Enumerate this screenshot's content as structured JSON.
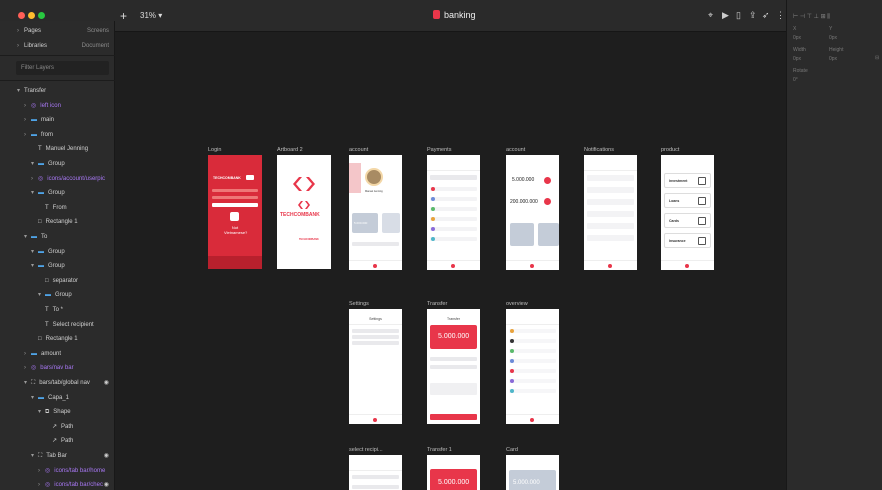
{
  "toolbar": {
    "plus": "+",
    "zoom": "31%",
    "title": "banking",
    "colors": {
      "red": "#ff5f57",
      "yellow": "#febc2e",
      "green": "#28c840",
      "brand": "#e8364a"
    }
  },
  "left_panel": {
    "pages_label": "Pages",
    "pages_right": "Screens",
    "libraries_label": "Libraries",
    "libraries_right": "Document",
    "filter_placeholder": "Filter Layers",
    "layers": [
      {
        "label": "Transfer",
        "icon": "none",
        "indent": 0
      },
      {
        "label": "left icon",
        "icon": "symbol",
        "indent": 1
      },
      {
        "label": "main",
        "icon": "folder",
        "indent": 1
      },
      {
        "label": "from",
        "icon": "folder",
        "indent": 1
      },
      {
        "label": "Manuel Jenning",
        "icon": "text",
        "indent": 2
      },
      {
        "label": "Group",
        "icon": "folder",
        "indent": 2
      },
      {
        "label": "icons/account/userpic",
        "icon": "symbol",
        "indent": 2
      },
      {
        "label": "Group",
        "icon": "folder",
        "indent": 2
      },
      {
        "label": "From",
        "icon": "text",
        "indent": 3
      },
      {
        "label": "Rectangle 1",
        "icon": "rect",
        "indent": 2
      },
      {
        "label": "To",
        "icon": "folder",
        "indent": 1
      },
      {
        "label": "Group",
        "icon": "folder",
        "indent": 2
      },
      {
        "label": "Group",
        "icon": "folder",
        "indent": 2
      },
      {
        "label": "separator",
        "icon": "rect",
        "indent": 3
      },
      {
        "label": "Group",
        "icon": "folder",
        "indent": 3
      },
      {
        "label": "To *",
        "icon": "text",
        "indent": 3
      },
      {
        "label": "Select recipient",
        "icon": "text",
        "indent": 3
      },
      {
        "label": "Rectangle 1",
        "icon": "rect",
        "indent": 2
      },
      {
        "label": "amount",
        "icon": "folder",
        "indent": 1
      },
      {
        "label": "bars/nav bar",
        "icon": "symbol",
        "indent": 1
      },
      {
        "label": "bars/tab/global nav",
        "icon": "frame",
        "indent": 1
      },
      {
        "label": "Capa_1",
        "icon": "folder",
        "indent": 2
      },
      {
        "label": "Shape",
        "icon": "shape",
        "indent": 3
      },
      {
        "label": "Path",
        "icon": "path",
        "indent": 4
      },
      {
        "label": "Path",
        "icon": "path",
        "indent": 4
      },
      {
        "label": "Tab Bar",
        "icon": "frame",
        "indent": 2
      },
      {
        "label": "icons/tab bar/home",
        "icon": "symbol",
        "indent": 3
      },
      {
        "label": "icons/tab bar/chec",
        "icon": "symbol",
        "indent": 3
      }
    ]
  },
  "right_panel": {
    "x_label": "X",
    "x_value": "0px",
    "y_label": "Y",
    "y_value": "0px",
    "w_label": "Width",
    "w_value": "0px",
    "h_label": "Height",
    "h_value": "0px",
    "rot_label": "Rotate",
    "rot_value": "0°"
  },
  "artboards": {
    "login": {
      "title": "Login",
      "brand": "TECHCOMBANK",
      "cta": "Not Vietnamese?"
    },
    "artboard2": {
      "title": "Artboard 2",
      "brand": "TECHCOMBANK",
      "sub": "TECHCOMBANK"
    },
    "account": {
      "title": "account",
      "name": "Manuel Jenning",
      "balance": "5.000.000"
    },
    "payments": {
      "title": "Payments"
    },
    "account2": {
      "title": "account",
      "balance1": "5.000.000",
      "balance2": "200.000.000"
    },
    "notifications": {
      "title": "Notifications"
    },
    "product": {
      "title": "product",
      "items": [
        "Investment",
        "Loans",
        "Cards",
        "Insurance"
      ]
    },
    "settings": {
      "title": "Settings",
      "header": "Settings"
    },
    "transfer": {
      "title": "Transfer",
      "header": "Transfer",
      "amount": "5.000.000"
    },
    "overview": {
      "title": "overview"
    },
    "select_recipient": {
      "title": "select recipi..."
    },
    "transfer1": {
      "title": "Transfer 1",
      "amount": "5.000.000"
    },
    "card": {
      "title": "Card",
      "amount": "5.000.000"
    }
  }
}
